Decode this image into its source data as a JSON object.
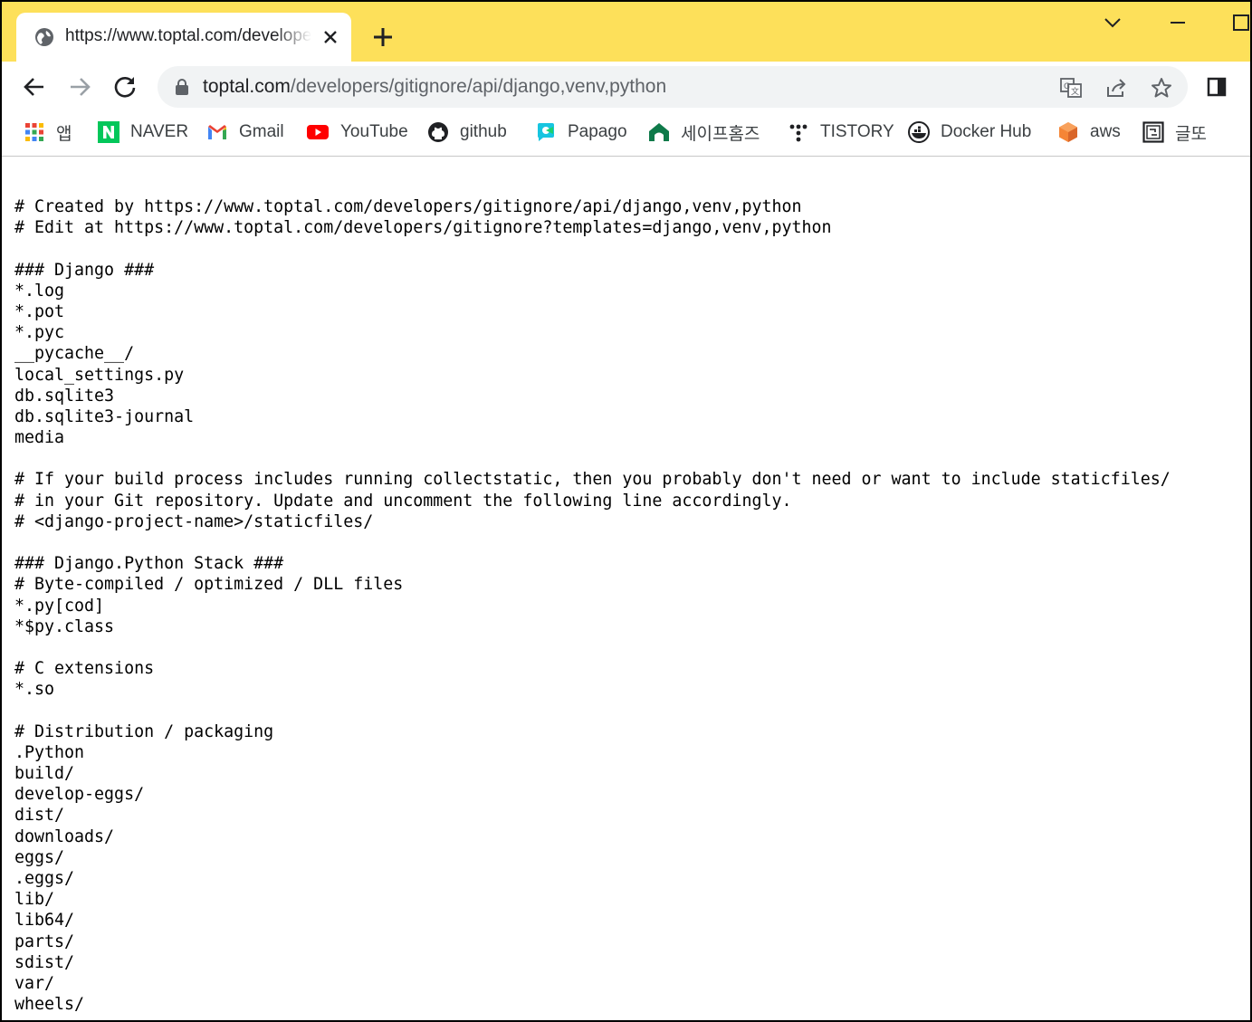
{
  "tab": {
    "title": "https://www.toptal.com/developers/gitignore/api/django,venv,python"
  },
  "omnibox": {
    "url_host": "toptal.com",
    "url_path": "/developers/gitignore/api/django,venv,python"
  },
  "bookmarks": [
    {
      "label": "앱",
      "icon": "apps-grid-icon"
    },
    {
      "label": "NAVER",
      "icon": "naver-icon"
    },
    {
      "label": "Gmail",
      "icon": "gmail-icon"
    },
    {
      "label": "YouTube",
      "icon": "youtube-icon"
    },
    {
      "label": "github",
      "icon": "github-icon"
    },
    {
      "label": "Papago",
      "icon": "papago-icon"
    },
    {
      "label": "세이프홈즈",
      "icon": "safehomes-icon"
    },
    {
      "label": "TISTORY",
      "icon": "tistory-icon"
    },
    {
      "label": "Docker Hub",
      "icon": "docker-icon"
    },
    {
      "label": "aws",
      "icon": "aws-icon"
    },
    {
      "label": "글또",
      "icon": "geulto-icon"
    }
  ],
  "content_lines": [
    "# Created by https://www.toptal.com/developers/gitignore/api/django,venv,python",
    "# Edit at https://www.toptal.com/developers/gitignore?templates=django,venv,python",
    "",
    "### Django ###",
    "*.log",
    "*.pot",
    "*.pyc",
    "__pycache__/",
    "local_settings.py",
    "db.sqlite3",
    "db.sqlite3-journal",
    "media",
    "",
    "# If your build process includes running collectstatic, then you probably don't need or want to include staticfiles/",
    "# in your Git repository. Update and uncomment the following line accordingly.",
    "# <django-project-name>/staticfiles/",
    "",
    "### Django.Python Stack ###",
    "# Byte-compiled / optimized / DLL files",
    "*.py[cod]",
    "*$py.class",
    "",
    "# C extensions",
    "*.so",
    "",
    "# Distribution / packaging",
    ".Python",
    "build/",
    "develop-eggs/",
    "dist/",
    "downloads/",
    "eggs/",
    ".eggs/",
    "lib/",
    "lib64/",
    "parts/",
    "sdist/",
    "var/",
    "wheels/"
  ]
}
